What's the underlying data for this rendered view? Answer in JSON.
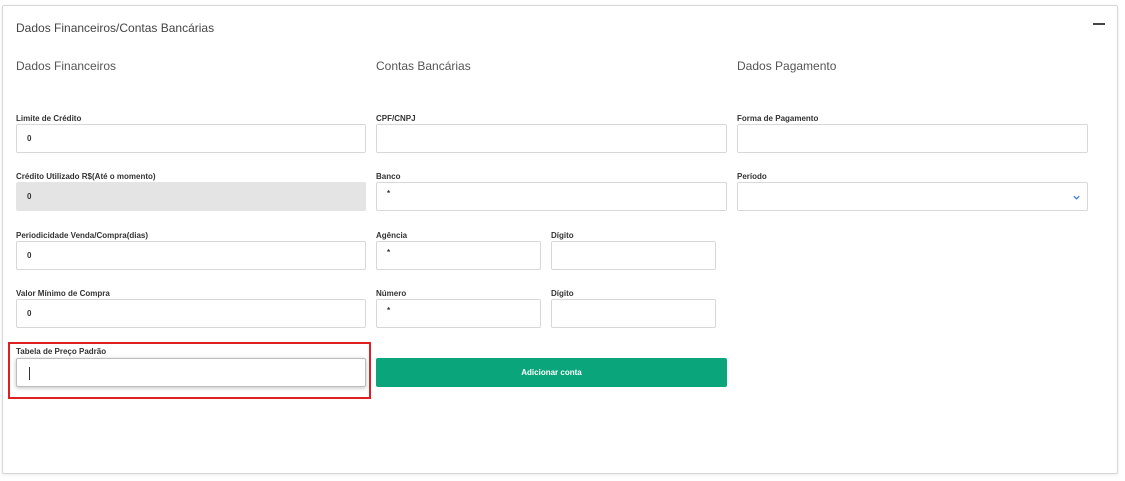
{
  "section": {
    "title": "Dados Financeiros/Contas Bancárias",
    "collapse_icon": "minus-icon"
  },
  "columns": {
    "financeiros": "Dados Financeiros",
    "contas": "Contas Bancárias",
    "pagamento": "Dados Pagamento"
  },
  "financeiros": {
    "limite_label": "Limite de Crédito",
    "limite_value": "0",
    "credito_utilizado_label": "Crédito Utilizado R$(Até o momento)",
    "credito_utilizado_value": "0",
    "periodicidade_label": "Periodicidade Venda/Compra(dias)",
    "periodicidade_value": "0",
    "valor_minimo_label": "Valor Mínimo de Compra",
    "valor_minimo_value": "0",
    "tabela_preco_label": "Tabela de Preço Padrão",
    "tabela_preco_value": ""
  },
  "contas": {
    "cpf_label": "CPF/CNPJ",
    "cpf_value": "",
    "banco_label": "Banco",
    "banco_value": "*",
    "agencia_label": "Agência",
    "agencia_value": "*",
    "agencia_digito_label": "Dígito",
    "agencia_digito_value": "",
    "numero_label": "Número",
    "numero_value": "*",
    "numero_digito_label": "Dígito",
    "numero_digito_value": "",
    "add_button_label": "Adicionar conta"
  },
  "pagamento": {
    "forma_label": "Forma de Pagamento",
    "forma_value": "",
    "periodo_label": "Período",
    "periodo_value": ""
  },
  "colors": {
    "accent": "#0aa57a",
    "highlight": "#e02020",
    "disabled_bg": "#e4e4e4",
    "select_chevron": "#3b7ddd"
  }
}
